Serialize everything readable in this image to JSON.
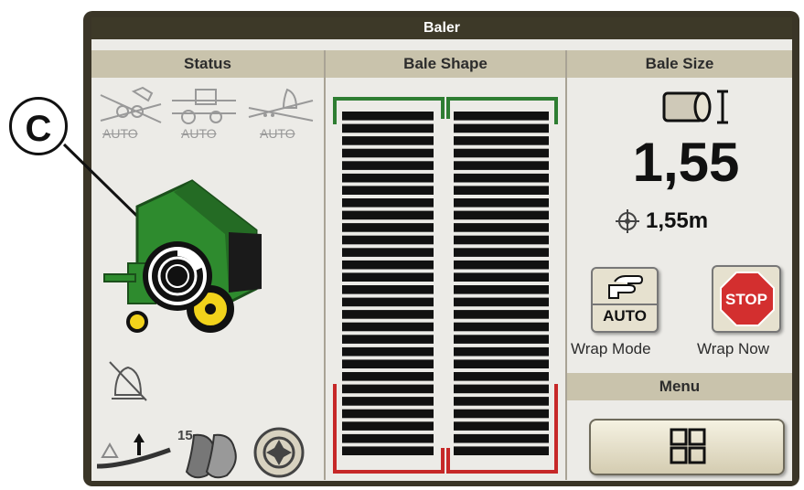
{
  "window": {
    "title": "Baler"
  },
  "callout": {
    "label": "C"
  },
  "status": {
    "header": "Status",
    "auto_labels": [
      "AUTO",
      "AUTO",
      "AUTO"
    ],
    "counter": "15"
  },
  "bale_shape": {
    "header": "Bale Shape",
    "left_bar_count": 28,
    "right_bar_count": 28
  },
  "bale_size": {
    "header": "Bale Size",
    "value": "1,55",
    "target": "1,55m",
    "auto_button_label": "AUTO",
    "stop_button_label": "STOP",
    "wrap_mode_label": "Wrap Mode",
    "wrap_now_label": "Wrap Now",
    "menu_header": "Menu"
  },
  "colors": {
    "frame": "#3a3527",
    "header_bg": "#c9c3ac",
    "screen_bg": "#ecebe7",
    "bale_bar": "#111111",
    "bracket_top": "#2e7d32",
    "bracket_bottom": "#c62828",
    "stop_red": "#d32f2f",
    "baler_green": "#2e8b2e",
    "baler_yellow": "#f2d31b"
  },
  "icons": {
    "rake_icon": "hay-rake-icon",
    "tractor_icon": "tractor-baler-icon",
    "drive_icon": "driver-icon",
    "baler_icon": "round-baler-icon",
    "wrap_knob_icon": "wrap-knob-icon",
    "no_alarm_icon": "alarm-off-icon",
    "pickup_icon": "pickup-raise-icon",
    "footprint_icon": "knives-icon",
    "gear_icon": "gear-knob-icon",
    "bale_icon": "bale-cylinder-icon",
    "target_icon": "target-icon",
    "hand_icon": "pointing-hand-icon",
    "grid_icon": "menu-grid-icon"
  }
}
